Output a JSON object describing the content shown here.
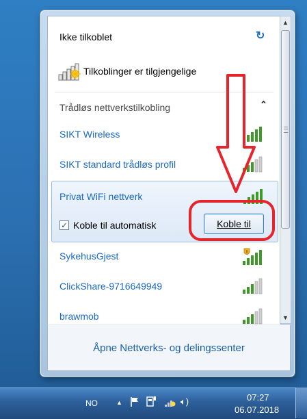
{
  "header": {
    "status": "Ikke tilkoblet",
    "refresh_icon": "refresh-icon",
    "connections_available": "Tilkoblinger er tilgjengelige"
  },
  "section": {
    "title": "Trådløs nettverkstilkobling",
    "collapse_icon": "chevron-up-icon"
  },
  "networks": [
    {
      "name": "SIKT Wireless",
      "signal": 5,
      "secured": false
    },
    {
      "name": "SIKT standard trådløs profil",
      "signal": 3,
      "secured": false
    },
    {
      "name": "Privat WiFi nettverk",
      "signal": 5,
      "secured": false,
      "selected": true
    },
    {
      "name": "SykehusGjest",
      "signal": 5,
      "secured": false,
      "warning": true
    },
    {
      "name": "ClickShare-9716649949",
      "signal": 3,
      "secured": false
    },
    {
      "name": "brawmob",
      "signal": 3,
      "secured": false
    }
  ],
  "selected_network": {
    "auto_connect_label": "Koble til automatisk",
    "auto_connect_checked": true,
    "connect_button": "Koble til"
  },
  "footer": {
    "open_center_link": "Åpne Nettverks- og delingssenter"
  },
  "taskbar": {
    "language": "NO",
    "time": "07:27",
    "date": "06.07.2018"
  },
  "colors": {
    "link": "#1b6ac9",
    "annotation": "#e5242b",
    "desktop": "#2b6fb0"
  }
}
